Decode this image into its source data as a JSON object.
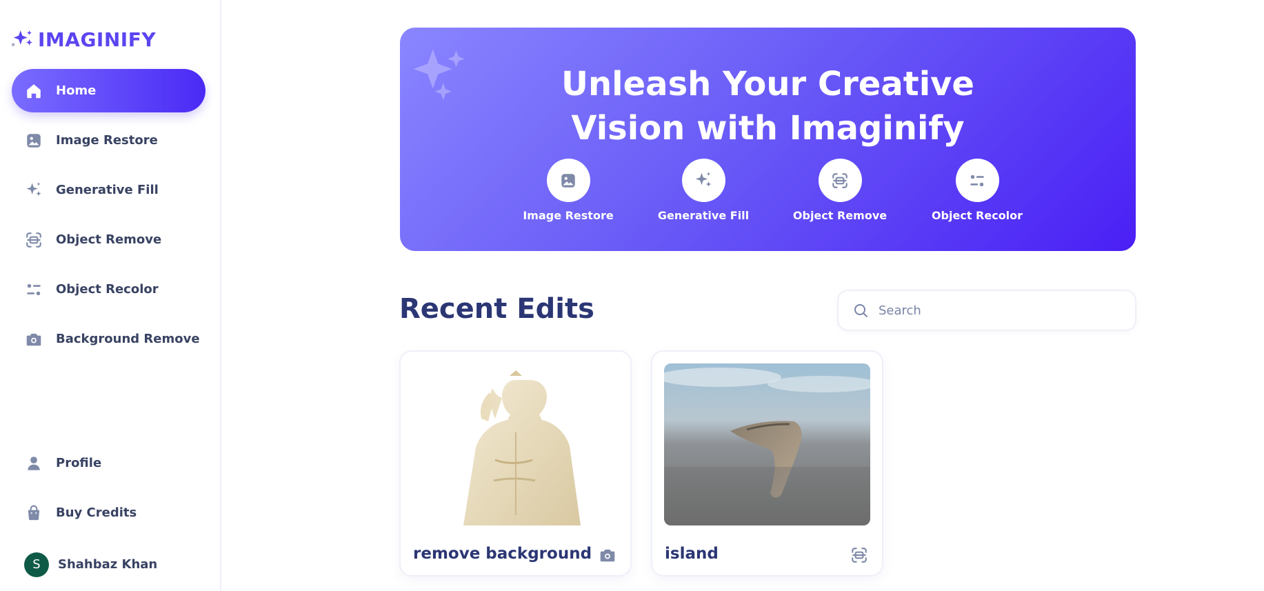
{
  "brand": {
    "name": "IMAGINIFY"
  },
  "sidebar": {
    "items": [
      {
        "label": "Home",
        "icon": "home-icon",
        "active": true
      },
      {
        "label": "Image Restore",
        "icon": "image-icon"
      },
      {
        "label": "Generative Fill",
        "icon": "sparkles-icon"
      },
      {
        "label": "Object Remove",
        "icon": "scan-icon"
      },
      {
        "label": "Object Recolor",
        "icon": "filter-icon"
      },
      {
        "label": "Background Remove",
        "icon": "camera-icon"
      }
    ],
    "bottom": [
      {
        "label": "Profile",
        "icon": "user-icon"
      },
      {
        "label": "Buy Credits",
        "icon": "bag-icon"
      }
    ],
    "user": {
      "name": "Shahbaz Khan",
      "initial": "S",
      "avatar_color": "#0f5a47"
    }
  },
  "hero": {
    "title_line1": "Unleash Your Creative",
    "title_line2": "Vision with Imaginify",
    "features": [
      {
        "label": "Image Restore",
        "icon": "image-icon"
      },
      {
        "label": "Generative Fill",
        "icon": "sparkles-icon"
      },
      {
        "label": "Object Remove",
        "icon": "scan-icon"
      },
      {
        "label": "Object Recolor",
        "icon": "filter-icon"
      }
    ]
  },
  "recent": {
    "title": "Recent Edits",
    "search_placeholder": "Search",
    "cards": [
      {
        "title": "remove background",
        "icon": "camera-icon"
      },
      {
        "title": "island",
        "icon": "scan-icon"
      }
    ]
  },
  "colors": {
    "accent": "#5b45f0",
    "text_dark": "#2b3674",
    "icon_gray": "#7f8aa8"
  }
}
